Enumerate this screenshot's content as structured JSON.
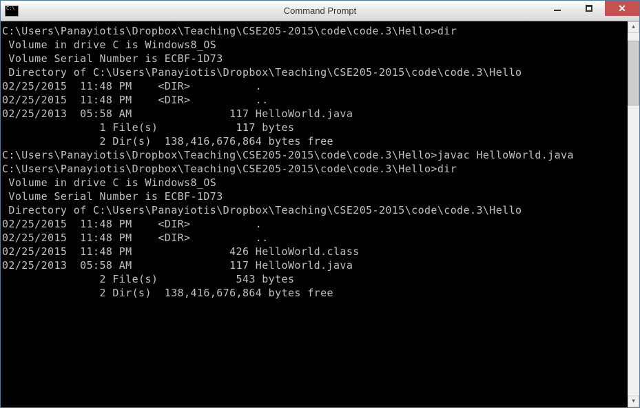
{
  "window": {
    "title": "Command Prompt"
  },
  "terminal": {
    "lines": [
      "",
      "C:\\Users\\Panayiotis\\Dropbox\\Teaching\\CSE205-2015\\code\\code.3\\Hello>dir",
      " Volume in drive C is Windows8_OS",
      " Volume Serial Number is ECBF-1D73",
      "",
      " Directory of C:\\Users\\Panayiotis\\Dropbox\\Teaching\\CSE205-2015\\code\\code.3\\Hello",
      "",
      "02/25/2015  11:48 PM    <DIR>          .",
      "02/25/2015  11:48 PM    <DIR>          ..",
      "02/25/2013  05:58 AM               117 HelloWorld.java",
      "               1 File(s)            117 bytes",
      "               2 Dir(s)  138,416,676,864 bytes free",
      "",
      "C:\\Users\\Panayiotis\\Dropbox\\Teaching\\CSE205-2015\\code\\code.3\\Hello>javac HelloWorld.java",
      "",
      "C:\\Users\\Panayiotis\\Dropbox\\Teaching\\CSE205-2015\\code\\code.3\\Hello>dir",
      " Volume in drive C is Windows8_OS",
      " Volume Serial Number is ECBF-1D73",
      "",
      " Directory of C:\\Users\\Panayiotis\\Dropbox\\Teaching\\CSE205-2015\\code\\code.3\\Hello",
      "",
      "02/25/2015  11:48 PM    <DIR>          .",
      "02/25/2015  11:48 PM    <DIR>          ..",
      "02/25/2015  11:48 PM               426 HelloWorld.class",
      "02/25/2013  05:58 AM               117 HelloWorld.java",
      "               2 File(s)            543 bytes",
      "               2 Dir(s)  138,416,676,864 bytes free"
    ]
  },
  "scrollbar": {
    "thumb_top_pct": 2,
    "thumb_height_pct": 18
  }
}
